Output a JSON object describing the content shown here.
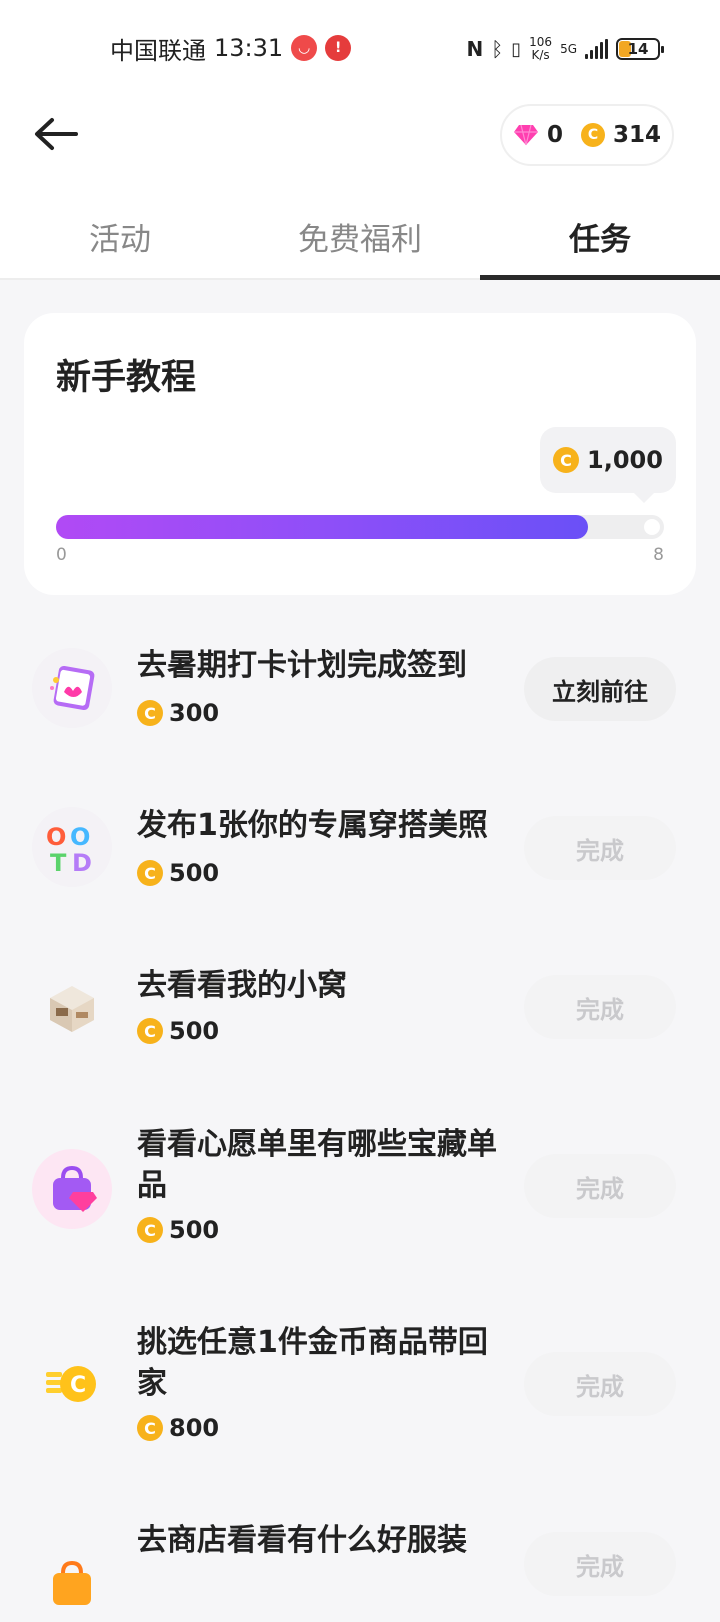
{
  "status_bar": {
    "carrier": "中国联通",
    "time": "13:31",
    "net_speed_value": "106",
    "net_speed_unit": "K/s",
    "network": "5G",
    "battery": "14"
  },
  "header": {
    "diamond_count": "0",
    "coin_count": "314"
  },
  "tabs": [
    {
      "label": "活动",
      "active": false
    },
    {
      "label": "免费福利",
      "active": false
    },
    {
      "label": "任务",
      "active": true
    }
  ],
  "tutorial": {
    "title": "新手教程",
    "reward": "1,000",
    "progress_min": "0",
    "progress_max": "8",
    "progress_fraction": 0.875
  },
  "tasks": [
    {
      "title": "去暑期打卡计划完成签到",
      "reward": "300",
      "button": "立刻前往",
      "state": "go",
      "icon": "calendar-checkin-icon"
    },
    {
      "title": "发布1张你的专属穿搭美照",
      "reward": "500",
      "button": "完成",
      "state": "done",
      "icon": "ootd-balloon-icon"
    },
    {
      "title": "去看看我的小窝",
      "reward": "500",
      "button": "完成",
      "state": "done",
      "icon": "room-icon"
    },
    {
      "title": "看看心愿单里有哪些宝藏单品",
      "reward": "500",
      "button": "完成",
      "state": "done",
      "icon": "wishlist-bag-icon"
    },
    {
      "title": "挑选任意1件金币商品带回家",
      "reward": "800",
      "button": "完成",
      "state": "done",
      "icon": "gold-coins-icon"
    },
    {
      "title": "去商店看看有什么好服装",
      "reward": "",
      "button": "完成",
      "state": "done",
      "icon": "shopping-bag-icon"
    }
  ],
  "colors": {
    "coin": "#f7b21b",
    "progress_start": "#b14af5",
    "progress_end": "#6a50f7",
    "done_text": "#c9c9cc"
  }
}
